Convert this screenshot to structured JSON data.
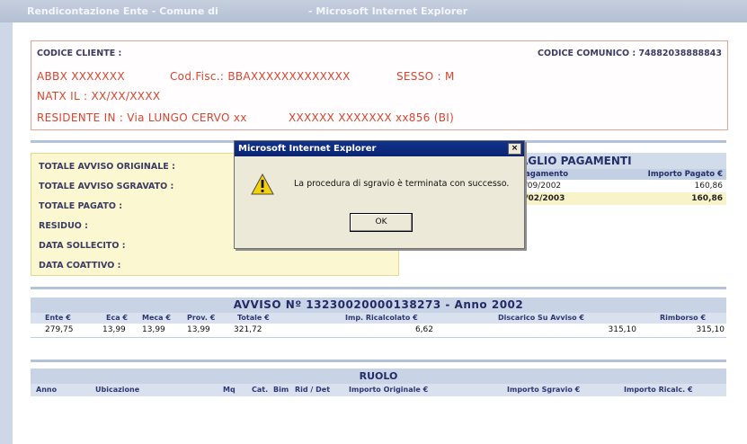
{
  "window": {
    "title_left": "Rendicontazione Ente - Comune di",
    "title_right": "- Microsoft Internet Explorer"
  },
  "client": {
    "codice_cliente_label": "CODICE CLIENTE :",
    "codice_comunico": "CODICE COMUNICO : 74882038888843",
    "name": "ABBX XXXXXXX",
    "codfisc": "Cod.Fisc.: BBAXXXXXXXXXXXXX",
    "sesso": "SESSO : M",
    "nato": "NATX IL : XX/XX/XXXX",
    "residente": "RESIDENTE IN : Via LUNGO CERVO xx",
    "residente2": "XXXXXX XXXXXXX xx856 (BI)"
  },
  "totals": {
    "labels": [
      "TOTALE AVVISO ORIGINALE :",
      "TOTALE AVVISO SGRAVATO :",
      "TOTALE PAGATO :",
      "RESIDUO :",
      "DATA SOLLECITO :",
      "DATA COATTIVO :"
    ]
  },
  "payments": {
    "title": "AGLIO PAGAMENTI",
    "col_date": "Pagamento",
    "col_amount": "Importo Pagato €",
    "rows": [
      {
        "date": "5/09/2002",
        "amount": "160,86"
      },
      {
        "date": "1/02/2003",
        "amount": "160,86"
      }
    ]
  },
  "avviso": {
    "title": "AVVISO Nº 13230020000138273 - Anno 2002",
    "headers": [
      "Ente €",
      "Eca €",
      "Meca €",
      "Prov. €",
      "Totale €",
      "Imp. Ricalcolato €",
      "Discarico Su Avviso €",
      "Rimborso €"
    ],
    "values": [
      "279,75",
      "13,99",
      "13,99",
      "13,99",
      "321,72",
      "6,62",
      "315,10",
      "315,10"
    ]
  },
  "ruolo": {
    "title": "RUOLO",
    "headers": [
      "Anno",
      "Ubicazione",
      "Mq",
      "Cat.",
      "Bim",
      "Rid / Det",
      "Importo Originale €",
      "Importo Sgravio €",
      "Importo Ricalc. €"
    ]
  },
  "dialog": {
    "title": "Microsoft Internet Explorer",
    "close": "×",
    "message": "La procedura di sgravio è terminata con successo.",
    "ok": "OK",
    "icon": "warning-icon",
    "colors": {
      "title_bg": "#0a2472",
      "warn": "#f5d10a"
    }
  }
}
